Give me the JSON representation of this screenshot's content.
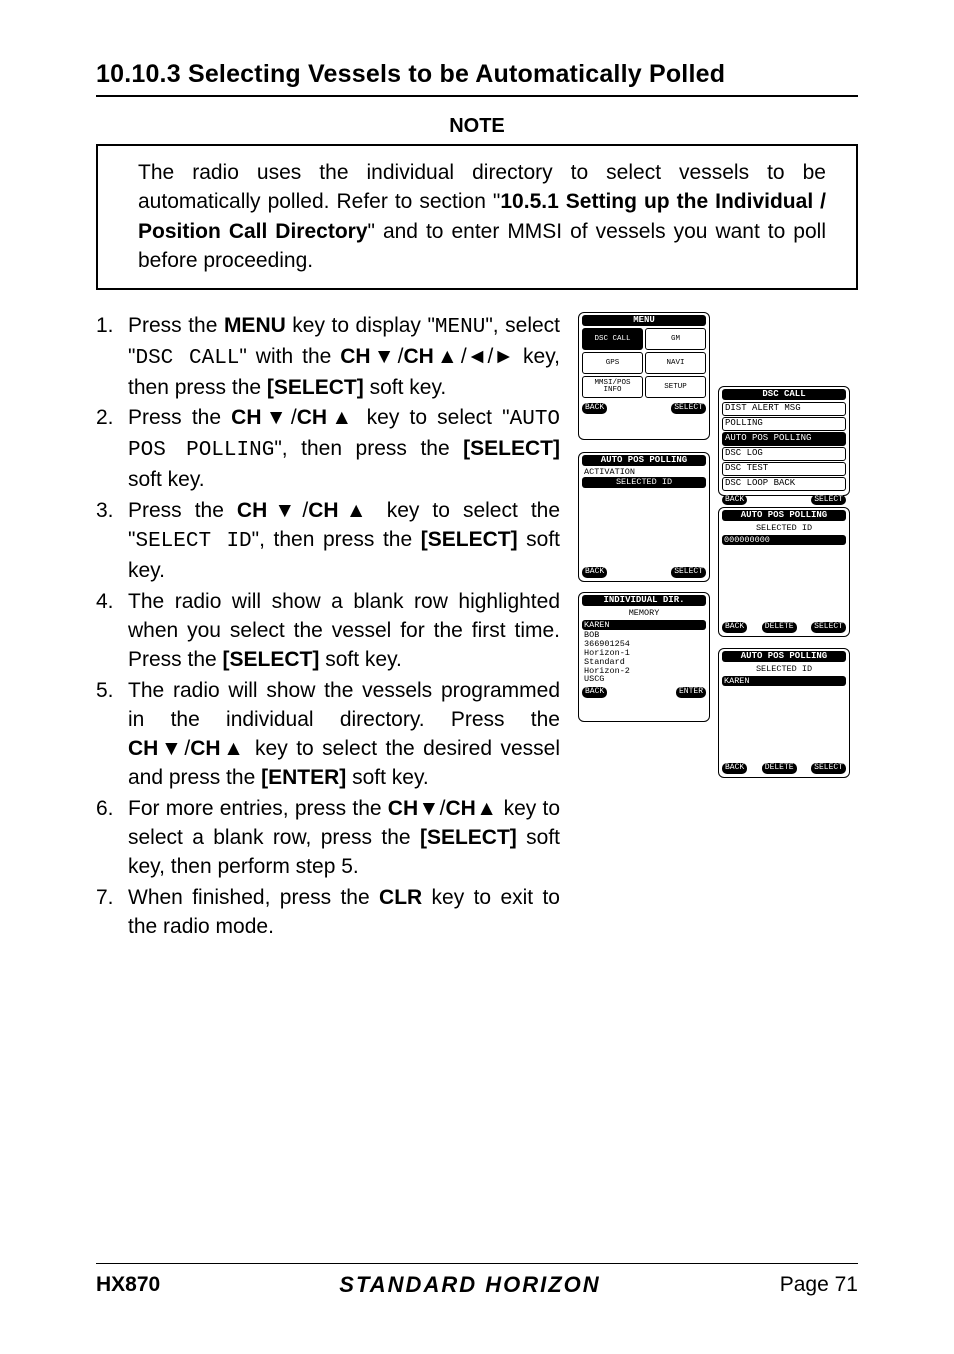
{
  "heading": "10.10.3  Selecting Vessels to be Automatically Polled",
  "note_label": "NOTE",
  "note_body_pre": "The radio uses the individual directory to select vessels to be automatically polled. Refer to section \"",
  "note_body_bold": "10.5.1  Setting up the Individual / Position Call Directory",
  "note_body_post": "\" and to enter MMSI of vessels you want to poll before proceeding.",
  "steps": {
    "s1": {
      "num": "1.",
      "p1": "Press the ",
      "menu_key": "MENU",
      "p2": " key to display \"",
      "menu_txt": "MENU",
      "p3": "\", select \"",
      "dsc_call": "DSC CALL",
      "p4": "\" with the ",
      "chdown": "CH▼",
      "chup": "CH▲",
      "left": "◄",
      "right": "►",
      "p5": " key, then press the ",
      "select": "[SELECT]",
      "p6": " soft key."
    },
    "s2": {
      "num": "2.",
      "p1": "Press the ",
      "p2": " key to select \"",
      "auto": "AUTO POS POLLING",
      "p3": "\", then press the ",
      "p4": " soft key."
    },
    "s3": {
      "num": "3.",
      "p1": "Press the ",
      "p2": " key to select the \"",
      "selid": "SELECT ID",
      "p3": "\", then press the ",
      "p4": " soft key."
    },
    "s4": {
      "num": "4.",
      "p1": "The radio will show a blank row highlighted when you select the vessel for the first time. Press the ",
      "p2": " soft key."
    },
    "s5": {
      "num": "5.",
      "p1": "The radio will show the vessels programmed in the individual directory. Press the ",
      "p2": " key to select the desired vessel and press the ",
      "enter": "[ENTER]",
      "p3": " soft key."
    },
    "s6": {
      "num": "6.",
      "p1": "For more entries, press the ",
      "p2": " key to select a blank row, press the ",
      "p3": " soft key, then perform step 5."
    },
    "s7": {
      "num": "7.",
      "p1": "When finished, press the ",
      "clr": "CLR",
      "p2": " key to exit to the radio mode."
    }
  },
  "lcd": {
    "menu": {
      "title": "MENU",
      "cells": [
        "DSC CALL",
        "GM",
        "GPS",
        "NAVI",
        "MMSI/POS INFO",
        "SETUP"
      ],
      "sk_left": "BACK",
      "sk_right": "SELECT"
    },
    "dsc_call_menu": {
      "title": "DSC CALL",
      "items": [
        "DIST ALERT MSG",
        "POLLING",
        "AUTO POS POLLING",
        "DSC LOG",
        "DSC TEST",
        "DSC LOOP BACK"
      ],
      "selected_index": 2,
      "sk_left": "BACK",
      "sk_right": "SELECT"
    },
    "app_menu": {
      "title": "AUTO POS POLLING",
      "items": [
        "ACTIVATION",
        "SELECTED ID"
      ],
      "selected_index": 1,
      "sk_left": "BACK",
      "sk_right": "SELECT"
    },
    "selid_blank": {
      "title": "AUTO POS POLLING",
      "sub": "SELECTED ID",
      "value": "000000000",
      "sk_left": "BACK",
      "sk_mid": "DELETE",
      "sk_right": "SELECT"
    },
    "dir": {
      "title": "INDIVIDUAL DIR.",
      "sub": "MEMORY",
      "items": [
        "KAREN",
        "BOB",
        "366901254",
        "Horizon-1",
        "Standard",
        "Horizon-2",
        "USCG"
      ],
      "selected_index": 0,
      "sk_left": "BACK",
      "sk_right": "ENTER"
    },
    "selid_karen": {
      "title": "AUTO POS POLLING",
      "sub": "SELECTED ID",
      "value": "KAREN",
      "sk_left": "BACK",
      "sk_mid": "DELETE",
      "sk_right": "SELECT"
    }
  },
  "footer": {
    "model": "HX870",
    "brand": "STANDARD HORIZON",
    "page": "Page 71"
  }
}
